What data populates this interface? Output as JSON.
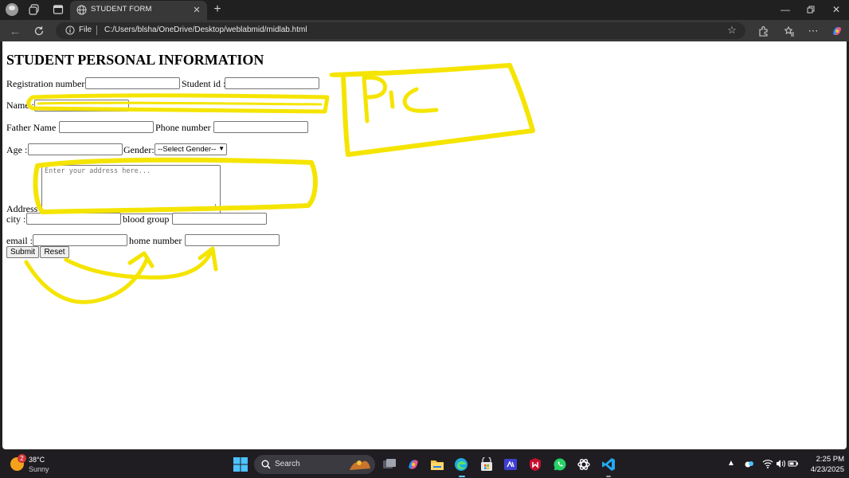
{
  "browser": {
    "tab_title": "STUDENT FORM",
    "address_scheme": "File",
    "url": "C:/Users/blsha/OneDrive/Desktop/weblabmid/midlab.html"
  },
  "form": {
    "heading": "STUDENT PERSONAL INFORMATION",
    "labels": {
      "registration": "Registration number :",
      "student_id": "Student id :",
      "name": "Name :",
      "father_name": "Father Name :",
      "phone": "Phone number :",
      "age": "Age :",
      "gender": "Gender:",
      "address": "Address :",
      "city": "city :",
      "blood_group": "blood group :",
      "email": "email :",
      "home_number": "home number :"
    },
    "gender_select": "--Select Gender--",
    "address_placeholder": "Enter your address here...",
    "submit": "Submit",
    "reset": "Reset"
  },
  "annotation": {
    "text": "Pic",
    "color": "#f5e400"
  },
  "taskbar": {
    "weather_temp": "38°C",
    "weather_condition": "Sunny",
    "weather_badge": "2",
    "search": "Search",
    "time": "2:25 PM",
    "date": "4/23/2025"
  }
}
